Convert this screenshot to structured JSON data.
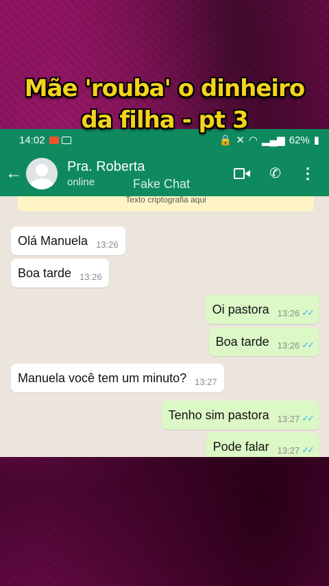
{
  "overlay": {
    "title_line1": "Mãe 'rouba' o dinheiro",
    "title_line2": "da filha - pt 3"
  },
  "status_bar": {
    "time": "14:02",
    "battery": "62%"
  },
  "chat_header": {
    "contact_name": "Pra. Roberta",
    "contact_status": "online",
    "watermark": "Fake Chat"
  },
  "encryption_banner": "Texto criptografia aqui",
  "messages": [
    {
      "direction": "in",
      "text": "Olá Manuela",
      "time": "13:26"
    },
    {
      "direction": "in",
      "text": "Boa tarde",
      "time": "13:26"
    },
    {
      "direction": "out",
      "text": "Oi pastora",
      "time": "13:26",
      "ticks": "✓✓"
    },
    {
      "direction": "out",
      "text": "Boa tarde",
      "time": "13:26",
      "ticks": "✓✓"
    },
    {
      "direction": "in",
      "text": "Manuela você tem um minuto?",
      "time": "13:27"
    },
    {
      "direction": "out",
      "text": "Tenho sim pastora",
      "time": "13:27",
      "ticks": "✓✓"
    },
    {
      "direction": "out",
      "text": "Pode falar",
      "time": "13:27",
      "ticks": "✓✓"
    }
  ],
  "colors": {
    "header_green": "#0f8a5f",
    "chat_background": "#ece5dd",
    "outgoing_bubble": "#dcf8c6",
    "incoming_bubble": "#ffffff",
    "read_ticks": "#34b7f1",
    "title_yellow": "#f4d31c",
    "background_magenta": "#8a0f5a"
  }
}
